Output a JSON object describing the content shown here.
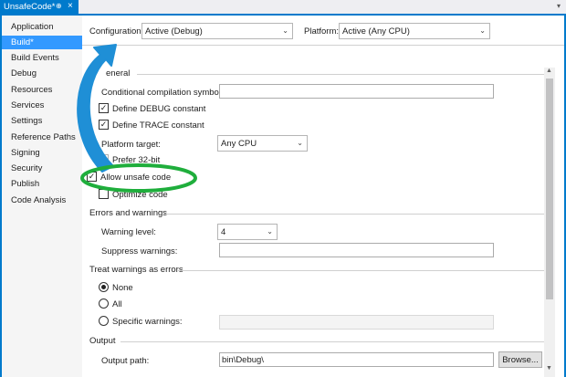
{
  "tab": {
    "title": "UnsafeCode*",
    "pin_glyph": "⊕",
    "close_glyph": "×",
    "overflow_glyph": "▾"
  },
  "sidebar": {
    "items": [
      {
        "label": "Application"
      },
      {
        "label": "Build*",
        "active": true
      },
      {
        "label": "Build Events"
      },
      {
        "label": "Debug"
      },
      {
        "label": "Resources"
      },
      {
        "label": "Services"
      },
      {
        "label": "Settings"
      },
      {
        "label": "Reference Paths"
      },
      {
        "label": "Signing"
      },
      {
        "label": "Security"
      },
      {
        "label": "Publish"
      },
      {
        "label": "Code Analysis"
      }
    ]
  },
  "config": {
    "configuration_label": "Configuration:",
    "configuration_value": "Active (Debug)",
    "platform_label": "Platform:",
    "platform_value": "Active (Any CPU)"
  },
  "general": {
    "header": "eneral",
    "conditional_label": "Conditional compilation symbols:",
    "conditional_value": "",
    "define_debug_label": "Define DEBUG constant",
    "define_debug_checked": true,
    "define_trace_label": "Define TRACE constant",
    "define_trace_checked": true,
    "platform_target_label": "Platform target:",
    "platform_target_value": "Any CPU",
    "prefer32_label": "Prefer 32-bit",
    "allow_unsafe_label": "Allow unsafe code",
    "allow_unsafe_checked": true,
    "optimize_label": "Optimize code",
    "optimize_checked": false
  },
  "errors": {
    "header": "Errors and warnings",
    "warning_level_label": "Warning level:",
    "warning_level_value": "4",
    "suppress_label": "Suppress warnings:",
    "suppress_value": ""
  },
  "treat": {
    "header": "Treat warnings as errors",
    "none_label": "None",
    "all_label": "All",
    "specific_label": "Specific warnings:",
    "selected": "None"
  },
  "output": {
    "header": "Output",
    "path_label": "Output path:",
    "path_value": "bin\\Debug\\",
    "browse_label": "Browse..."
  },
  "glyphs": {
    "check": "✓",
    "caret": "⌄",
    "scroll_up": "▲",
    "scroll_down": "▼"
  },
  "annotations": {
    "arrow_color": "#1f8fd6",
    "ellipse_color": "#1fae3c"
  }
}
